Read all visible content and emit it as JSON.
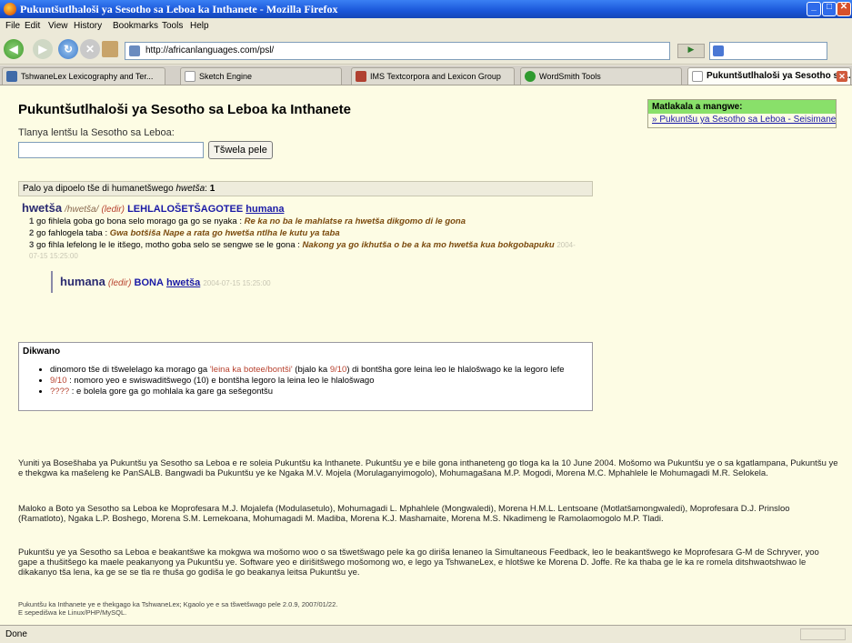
{
  "window": {
    "title": "Pukuntšutlhaloši ya Sesotho sa Leboa ka Inthanete - Mozilla Firefox"
  },
  "menu": {
    "items": [
      "File",
      "Edit",
      "View",
      "History",
      "Bookmarks",
      "Tools",
      "Help"
    ]
  },
  "nav": {
    "url": "http://africanlanguages.com/psl/"
  },
  "tabs": [
    {
      "label": "TshwaneLex Lexicography and Ter...",
      "icon": "tshwanelex-icon"
    },
    {
      "label": "Sketch Engine",
      "icon": "page-icon"
    },
    {
      "label": "IMS Textcorpora and Lexicon Group",
      "icon": "ims-icon"
    },
    {
      "label": "WordSmith Tools",
      "icon": "wordsmith-icon"
    },
    {
      "label": "Pukuntšutlhaloši ya Sesotho sa...",
      "icon": "page-icon",
      "active": true
    }
  ],
  "page": {
    "title": "Pukuntšutlhaloši ya Sesotho sa Leboa ka Inthanete",
    "sidebox": {
      "heading": "Matlakala a mangwe:",
      "link": "» Pukuntšu ya Sesotho sa Leboa - Seisimane"
    },
    "search": {
      "prompt": "Tlanya lentšu la Sesotho sa Leboa:",
      "value": "",
      "button": "Tšwela pele"
    },
    "result_count": {
      "text": "Palo ya dipoelo tše di humanetšwego ",
      "query": "hwetša",
      "count": "1"
    },
    "entry": {
      "headword": "hwetša",
      "phonetic": "/hwetša/",
      "pos": "(ledir)",
      "label": "LEHLALOŠETŠAGOTEE",
      "crossref": "humana",
      "senses": [
        {
          "n": "1",
          "def": "go fihlela goba go bona selo morago ga go se nyaka :",
          "example": "Re ka no ba le mahlatse ra hwetša dikgomo di le gona"
        },
        {
          "n": "2",
          "def": "go fahlogela taba :",
          "example": "Gwa botšiša Nape a rata go hwetša ntlha le kutu ya taba"
        },
        {
          "n": "3",
          "def": "go fihla lefelong le le itšego, motho goba selo se sengwe se le gona :",
          "example": "Nakong ya go ikhutša o be a ka mo hwetša kua bokgobapuku",
          "date": "2004-07-15 15:25:00"
        }
      ],
      "sub": {
        "headword": "humana",
        "pos": "(ledir)",
        "label": "BONA",
        "link": "hwetša",
        "date": "2004-07-15 15:25:00"
      }
    },
    "notes": {
      "title": "Dikwano",
      "items": [
        {
          "pre": "dinomoro tše di tšwelelago ka morago ga ",
          "hi": "'leina ka botee/bontši'",
          "mid": " (bjalo ka ",
          "hi2": "9/10",
          "post": ") di bontšha gore leina leo le hlalošwago ke la legoro lefe"
        },
        {
          "pre": "",
          "hi": "9/10",
          "mid": " : nomoro yeo e swiswaditšwego (10) e bontšha legoro la leina leo le hlalošwago",
          "hi2": "",
          "post": ""
        },
        {
          "pre": "",
          "hi": "????",
          "mid": " : e bolela gore ga go mohlala ka gare ga sešegontšu",
          "hi2": "",
          "post": ""
        }
      ]
    },
    "about": {
      "p1": "Yuniti ya Bosešhaba ya Pukuntšu ya Sesotho sa Leboa e re soleia Pukuntšu ka Inthanete. Pukuntšu ye e bile gona inthaneteng go tloga ka la 10 June 2004. Mošomo wa Pukuntšu ye o sa kgatlampana, Pukuntšu ye e thekgwa ka mašeleng ke PanSALB. Bangwadi ba Pukuntšu ye ke Ngaka M.V. Mojela (Morulaganyimogolo), Mohumagašana M.P. Mogodi, Morena M.C. Mphahlele le Mohumagadi M.R. Selokela.",
      "p2": "Maloko a Boto ya Sesotho sa Leboa ke Moprofesara M.J. Mojalefa (Modulasetulo), Mohumagadi L. Mphahlele (Mongwaledi), Morena H.M.L. Lentsoane (Motlatšamongwaledi), Moprofesara D.J. Prinsloo (Ramatloto), Ngaka L.P. Boshego, Morena S.M. Lemekoana, Mohumagadi M. Madiba, Morena K.J. Mashamaite, Morena M.S. Nkadimeng le Ramolaomogolo M.P. Tladi.",
      "p3": "Pukuntšu ye ya Sesotho sa Leboa e beakantšwe ka mokgwa wa mošomo woo o sa tšwetšwago pele ka go diriša lenaneo la Simultaneous Feedback, leo le beakantšwego ke Moprofesara G-M de Schryver, yoo gape a thušitšego ka maele peakanyong ya Pukuntšu ye. Software yeo e dirišitšwego mošomong wo, e lego ya TshwaneLex, e hlotšwe ke Morena D. Joffe. Re ka thaba ge le ka re romela ditshwaotshwao le dikakanyo tša lena, ka ge se se tla re thuša go godiša le go beakanya leitsa Pukuntšu ye."
    },
    "footer": {
      "line1": "Pukuntšu ka Inthanete ye e thekgago ka TshwaneLex; Kgaolo ye e sa tšwetšwago pele 2.0.9, 2007/01/22.",
      "line2": "E sepedišwa ke Linux/PHP/MySQL."
    }
  },
  "status": {
    "text": "Done"
  }
}
